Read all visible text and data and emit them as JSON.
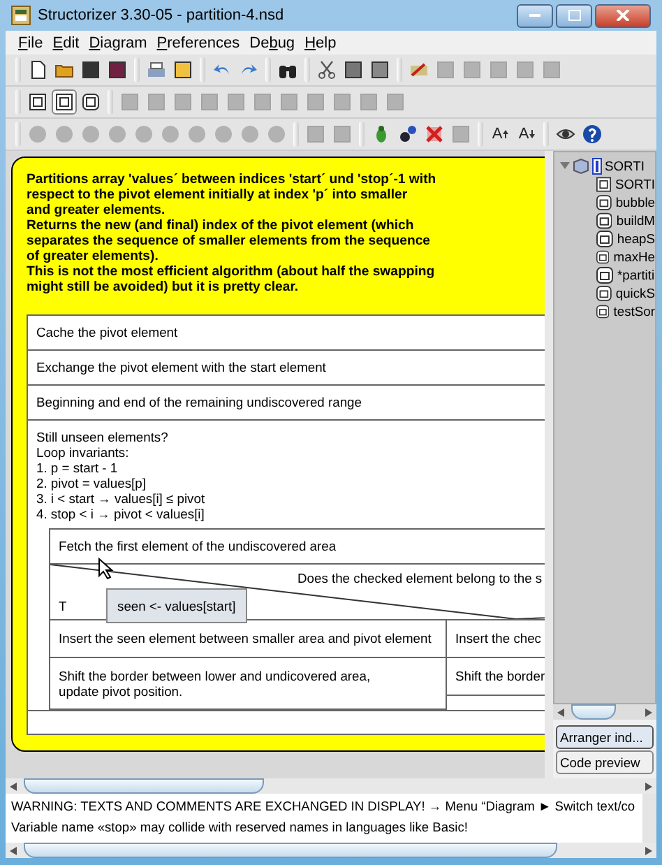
{
  "window": {
    "title": "Structorizer 3.30-05 - partition-4.nsd"
  },
  "menu": [
    {
      "key": "F",
      "after": "ile"
    },
    {
      "key": "E",
      "after": "dit"
    },
    {
      "key": "D",
      "after": "iagram"
    },
    {
      "key": "P",
      "after": "references"
    },
    {
      "before": "De",
      "key": "b",
      "after": "ug"
    },
    {
      "key": "H",
      "after": "elp"
    }
  ],
  "toolbars": [
    [
      [
        {
          "disabled": false
        },
        {
          "disabled": false
        },
        {
          "disabled": false
        },
        {
          "disabled": false
        }
      ],
      [
        {
          "disabled": false
        },
        {
          "disabled": false
        }
      ],
      [
        {
          "disabled": false
        },
        {
          "disabled": false
        }
      ],
      [
        {
          "disabled": false
        }
      ],
      [
        {
          "disabled": false
        },
        {
          "disabled": false
        },
        {
          "disabled": false
        }
      ],
      [
        {
          "disabled": false
        },
        {
          "disabled": true
        },
        {
          "disabled": true
        },
        {
          "disabled": true
        },
        {
          "disabled": true
        },
        {
          "disabled": true
        }
      ]
    ],
    [
      [
        {
          "disabled": false,
          "selected": false
        },
        {
          "disabled": false,
          "selected": true
        },
        {
          "disabled": false,
          "selected": false
        }
      ],
      [
        {
          "disabled": true
        },
        {
          "disabled": true
        },
        {
          "disabled": true
        },
        {
          "disabled": true
        },
        {
          "disabled": true
        },
        {
          "disabled": true
        },
        {
          "disabled": true
        },
        {
          "disabled": true
        },
        {
          "disabled": true
        },
        {
          "disabled": true
        },
        {
          "disabled": true
        }
      ]
    ],
    [
      [
        {
          "disabled": true
        },
        {
          "disabled": true
        },
        {
          "disabled": true
        },
        {
          "disabled": true
        },
        {
          "disabled": true
        },
        {
          "disabled": true
        },
        {
          "disabled": true
        },
        {
          "disabled": true
        },
        {
          "disabled": true
        },
        {
          "disabled": true
        }
      ],
      [
        {
          "disabled": true
        },
        {
          "disabled": true
        }
      ],
      [
        {
          "disabled": false
        },
        {
          "disabled": false
        },
        {
          "disabled": false
        },
        {
          "disabled": true
        }
      ],
      [
        {
          "disabled": false,
          "text": "A"
        },
        {
          "disabled": false,
          "text": "A"
        }
      ],
      [
        {
          "disabled": false
        },
        {
          "disabled": false
        }
      ]
    ]
  ],
  "diagram": {
    "comment": [
      "Partitions array 'values´ between indices 'start´ und 'stop´-1 with",
      "respect to the pivot element initially at index 'p´ into smaller",
      "and greater elements.",
      "Returns the new (and final) index of the pivot element (which",
      "separates the sequence of smaller elements from the sequence",
      "of greater elements).",
      "This is not the most efficient algorithm (about half the swapping",
      "might still be avoided) but it is pretty clear."
    ],
    "elements": [
      {
        "kind": "instruction",
        "lines": [
          "Cache the pivot element"
        ]
      },
      {
        "kind": "instruction",
        "lines": [
          "Exchange the pivot element with the start element"
        ]
      },
      {
        "kind": "instruction",
        "lines": [
          "Beginning and end of the remaining undiscovered range"
        ]
      },
      {
        "kind": "loop",
        "lines": [
          "Still unseen elements?",
          "Loop invariants:",
          "1. p = start - 1",
          "2. pivot = values[p]",
          "3. i < start → values[i] ≤ pivot",
          "4. stop < i → pivot < values[i]"
        ],
        "body": [
          {
            "kind": "instruction",
            "lines": [
              "Fetch the first element of the undiscovered area"
            ]
          },
          {
            "kind": "alternative",
            "condition": "Does the checked element belong to the s",
            "true_label": "T",
            "left": [
              {
                "kind": "instruction",
                "lines": [
                  "Insert the seen element between smaller area and pivot element"
                ]
              },
              {
                "kind": "instruction",
                "lines": [
                  "Shift the border between lower and undicovered area,",
                  "update pivot position."
                ]
              }
            ],
            "right": [
              {
                "kind": "instruction",
                "lines": [
                  "Insert the chec"
                ]
              },
              {
                "kind": "instruction",
                "lines": [
                  "Shift the border"
                ]
              }
            ]
          }
        ]
      }
    ],
    "tooltip": "seen <- values[start]"
  },
  "tree": {
    "label": "SORTI",
    "expanded": true,
    "children": [
      {
        "label": "SORTI",
        "kind": "main"
      },
      {
        "label": "bubble",
        "kind": "sub"
      },
      {
        "label": "buildM",
        "kind": "sub"
      },
      {
        "label": "heapS",
        "kind": "sub"
      },
      {
        "label": "maxHe",
        "kind": "sub"
      },
      {
        "label": "*partiti",
        "kind": "sub"
      },
      {
        "label": "quickS",
        "kind": "sub"
      },
      {
        "label": "testSor",
        "kind": "sub"
      }
    ]
  },
  "side_tabs": [
    {
      "label": "Arranger ind...",
      "selected": true
    },
    {
      "label": "Code preview",
      "selected": false
    }
  ],
  "messages": [
    "WARNING: TEXTS AND COMMENTS ARE EXCHANGED IN DISPLAY! → Menu “Diagram ► Switch text/co",
    "Variable name «stop» may collide with reserved names in languages like Basic!"
  ]
}
